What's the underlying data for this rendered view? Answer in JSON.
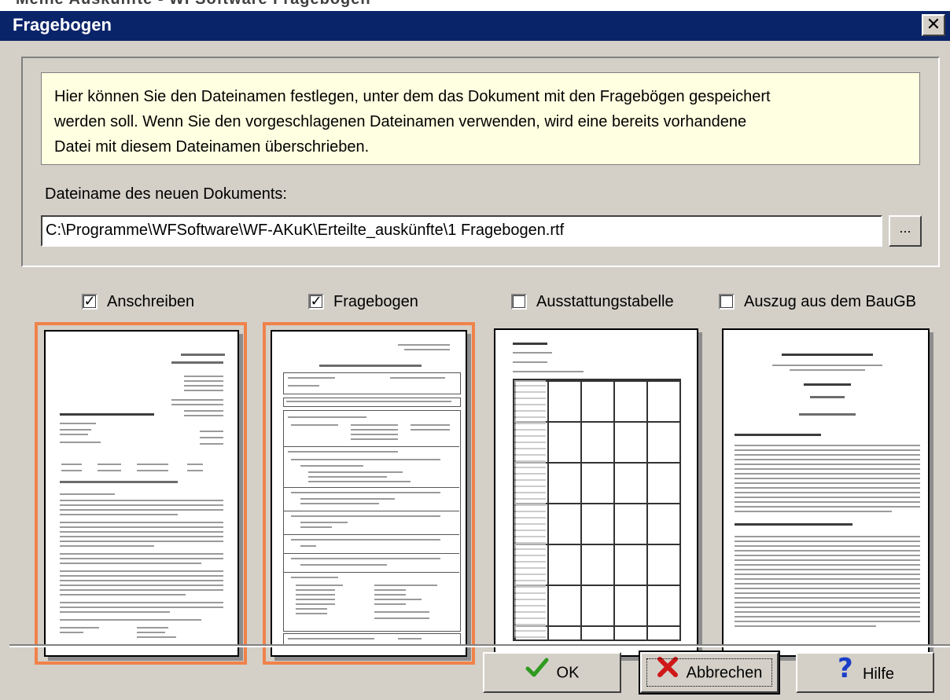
{
  "background_window": {
    "title_fragment": "Meine Auskunfte - WFSoftware Fragebogen"
  },
  "dialog": {
    "title": "Fragebogen",
    "close_glyph": "✕"
  },
  "info": {
    "lines": [
      "Hier können Sie den Dateinamen festlegen, unter dem das Dokument mit den Fragebögen gespeichert",
      "werden soll. Wenn Sie den vorgeschlagenen Dateinamen verwenden, wird eine bereits vorhandene",
      "Datei mit diesem Dateinamen überschrieben."
    ]
  },
  "file": {
    "label": "Dateiname des neuen Dokuments:",
    "value": "C:\\Programme\\WFSoftware\\WF-AKuK\\Erteilte_auskünfte\\1 Fragebogen.rtf",
    "browse_label": "..."
  },
  "documents": [
    {
      "label": "Anschreiben",
      "checked": true
    },
    {
      "label": "Fragebogen",
      "checked": true
    },
    {
      "label": "Ausstattungstabelle",
      "checked": false
    },
    {
      "label": "Auszug aus dem BauGB",
      "checked": false
    }
  ],
  "check_glyph": "✓",
  "buttons": {
    "ok": {
      "label": "OK",
      "icon": "checkmark-icon"
    },
    "cancel": {
      "label": "Abbrechen",
      "icon": "cross-icon"
    },
    "help": {
      "label": "Hilfe",
      "icon": "question-icon"
    }
  },
  "colors": {
    "title_bar": "#0a246a",
    "info_background": "#ffffe1",
    "selection_border": "#f0824a",
    "ok_icon": "#2e9a1e",
    "cancel_icon": "#d01818",
    "help_icon": "#1a3ec8"
  }
}
